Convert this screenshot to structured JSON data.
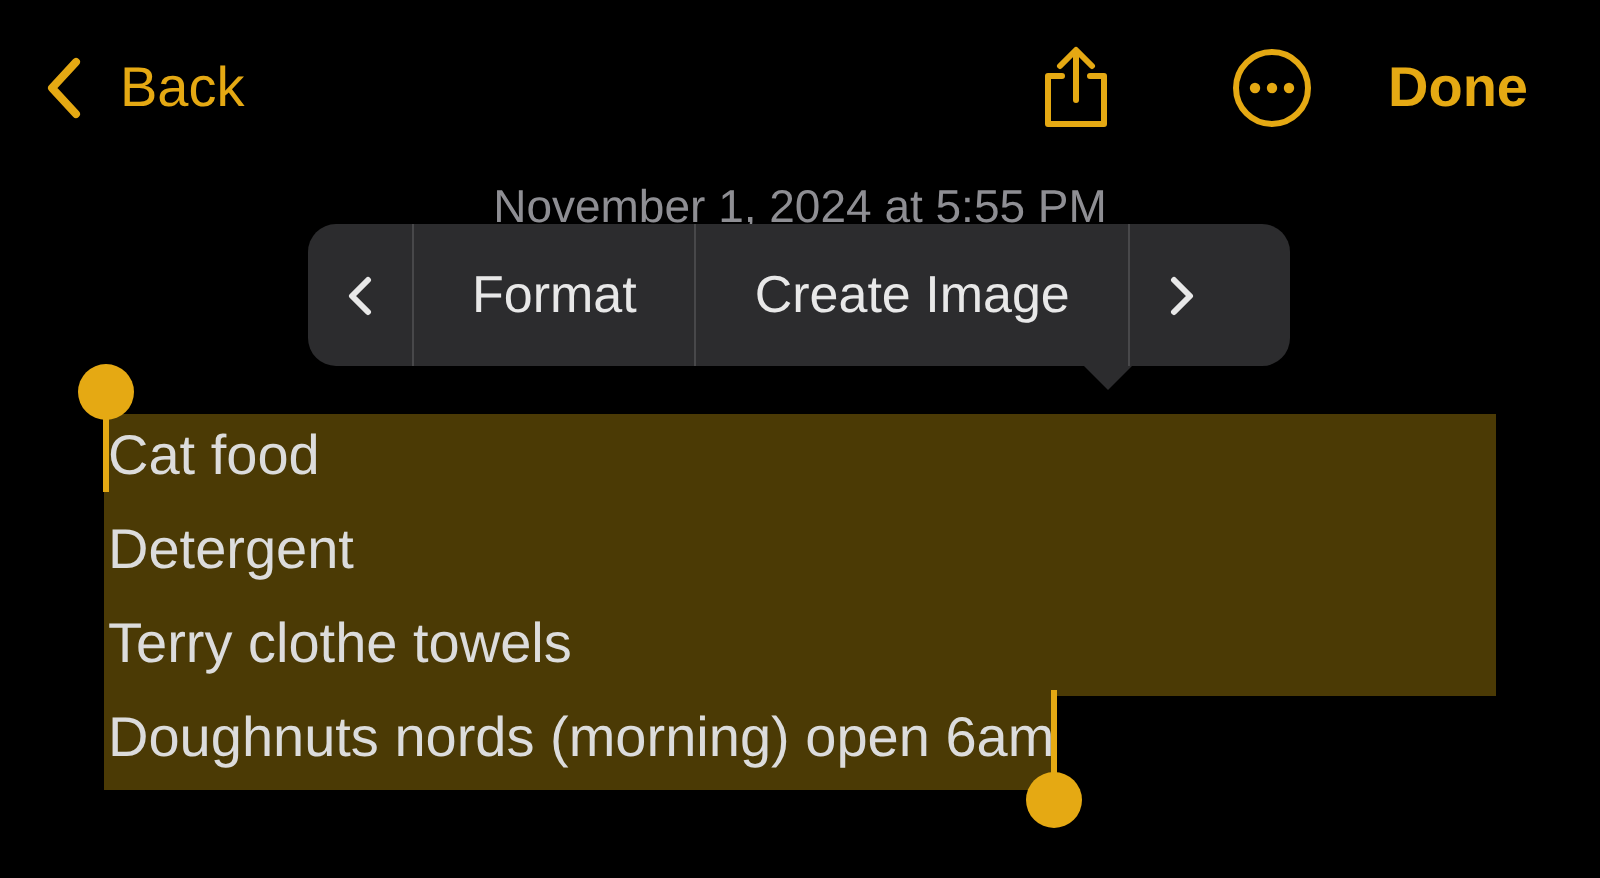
{
  "toolbar": {
    "back_label": "Back",
    "done_label": "Done"
  },
  "date": "November 1, 2024 at 5:55 PM",
  "edit_menu": {
    "items": [
      "Format",
      "Create Image"
    ]
  },
  "note_lines": [
    {
      "text": "Cat food",
      "selected": true
    },
    {
      "text": "Detergent",
      "selected": true
    },
    {
      "text": "Terry clothe towels",
      "selected": true
    },
    {
      "text": "Doughnuts nords (morning) open 6am",
      "selected": true
    }
  ]
}
